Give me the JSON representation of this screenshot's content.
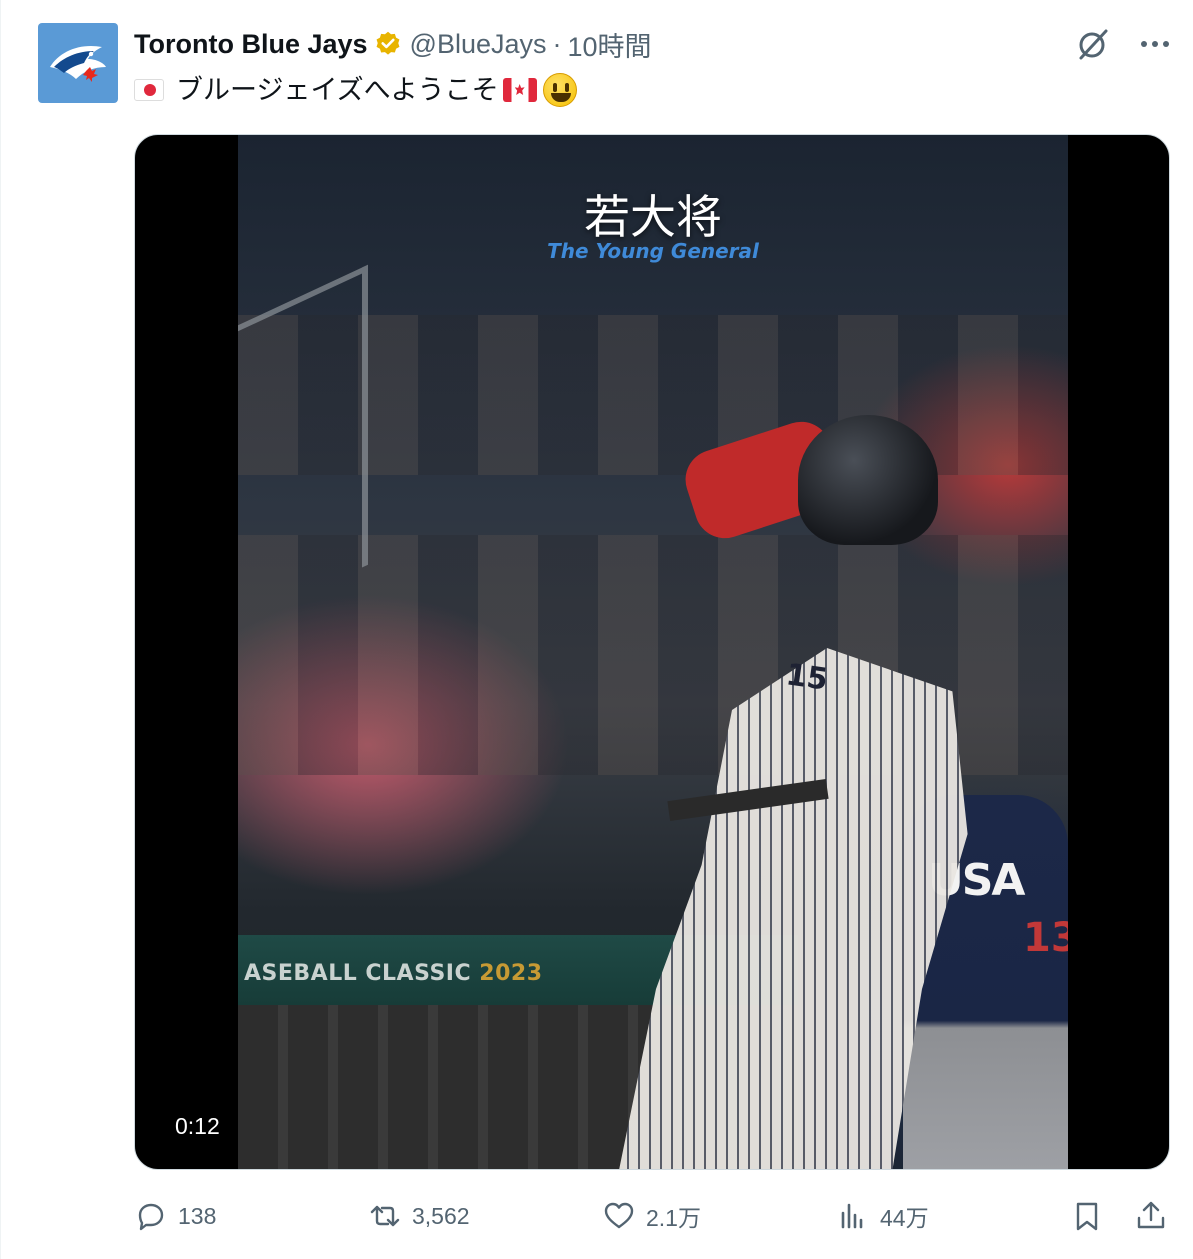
{
  "author": {
    "display_name": "Toronto Blue Jays",
    "handle": "@BlueJays",
    "separator": "·",
    "time": "10時間",
    "verified": true,
    "avatar_icon": "blue-jays-logo"
  },
  "tweet": {
    "text": "ブルージェイズへようこそ",
    "emoji": [
      "flag-japan-icon",
      "flag-canada-icon",
      "grinning-face-icon"
    ]
  },
  "media": {
    "type": "video",
    "overlay_title": "若大将",
    "overlay_subtitle": "The Young General",
    "wall_text": "ASEBALL CLASSIC",
    "wall_year": "2023",
    "jersey_number": "15",
    "usa_text": "USA",
    "usa_number": "13",
    "duration": "0:12"
  },
  "actions": {
    "replies": "138",
    "reposts": "3,562",
    "likes": "2.1万",
    "views": "44万"
  },
  "colors": {
    "secondary_text": "#536471",
    "accent_gold": "#e8b400",
    "subtitle_blue": "#3f8ad8"
  }
}
